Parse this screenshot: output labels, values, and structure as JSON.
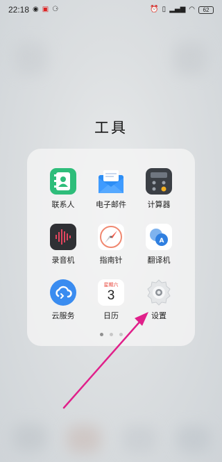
{
  "status_bar": {
    "time": "22:18",
    "left_icons": [
      "weibo-icon",
      "notification-icon",
      "app-icon"
    ],
    "right_icons": [
      "alarm-icon",
      "vibrate-icon",
      "signal-icon",
      "wifi-icon"
    ],
    "battery": "62"
  },
  "folder": {
    "title": "工具",
    "apps": [
      {
        "label": "联系人",
        "icon": "contacts-icon"
      },
      {
        "label": "电子邮件",
        "icon": "mail-icon"
      },
      {
        "label": "计算器",
        "icon": "calculator-icon"
      },
      {
        "label": "录音机",
        "icon": "recorder-icon"
      },
      {
        "label": "指南针",
        "icon": "compass-icon"
      },
      {
        "label": "翻译机",
        "icon": "translate-icon"
      },
      {
        "label": "云服务",
        "icon": "cloud-icon"
      },
      {
        "label": "日历",
        "icon": "calendar-icon",
        "calendar_weekday": "星期六",
        "calendar_day": "3"
      },
      {
        "label": "设置",
        "icon": "settings-gear-icon"
      }
    ],
    "pages": 3,
    "active_page": 1
  },
  "annotation": {
    "type": "arrow",
    "color": "#e0208a",
    "target": "settings"
  }
}
